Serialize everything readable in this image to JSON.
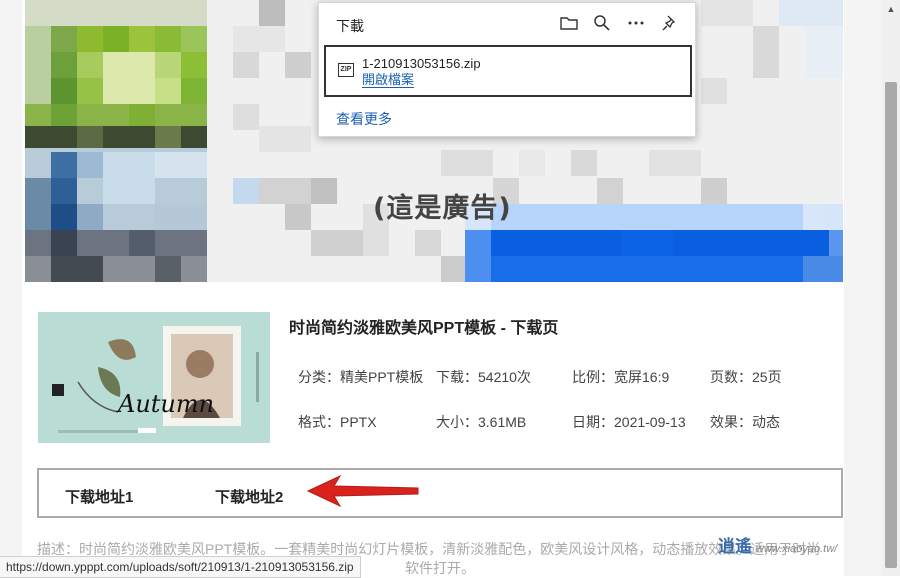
{
  "ad": {
    "label": "(這是廣告)"
  },
  "product": {
    "title": "时尚简约淡雅欧美风PPT模板 - 下载页",
    "thumbnail_text": "Autumn",
    "meta": [
      {
        "label": "分类：",
        "value": "精美PPT模板"
      },
      {
        "label": "下载：",
        "value": "54210次"
      },
      {
        "label": "比例：",
        "value": "宽屏16:9"
      },
      {
        "label": "页数：",
        "value": "25页"
      },
      {
        "label": "格式：",
        "value": "PPTX"
      },
      {
        "label": "大小：",
        "value": "3.61MB"
      },
      {
        "label": "日期：",
        "value": "2021-09-13"
      },
      {
        "label": "效果：",
        "value": "动态"
      }
    ]
  },
  "downloads": {
    "link1": "下载地址1",
    "link2": "下载地址2"
  },
  "description": {
    "line1": "描述：时尚简约淡雅欧美风PPT模板。一套精美时尚幻灯片模板，清新淡雅配色，欧美风设计风格，动态播放效果。适用于时尚",
    "line2": "软件打开。"
  },
  "status_bar": {
    "url": "https://down.ypppt.com/uploads/soft/210913/1-210913053156.zip"
  },
  "watermark": {
    "brand": "逍遙",
    "site": "www.xiaoyao.tw/"
  },
  "download_panel": {
    "title": "下載",
    "icons": [
      "folder-icon",
      "search-icon",
      "more-icon",
      "pin-icon"
    ],
    "file_icon_text": "ZIP",
    "file_name": "1-210913053156.zip",
    "open_file": "開啟檔案",
    "see_more": "查看更多"
  },
  "colors": {
    "link_blue": "#1a5fb4",
    "arrow_red": "#d9221c",
    "ad_blue": "#0a5fe0"
  }
}
